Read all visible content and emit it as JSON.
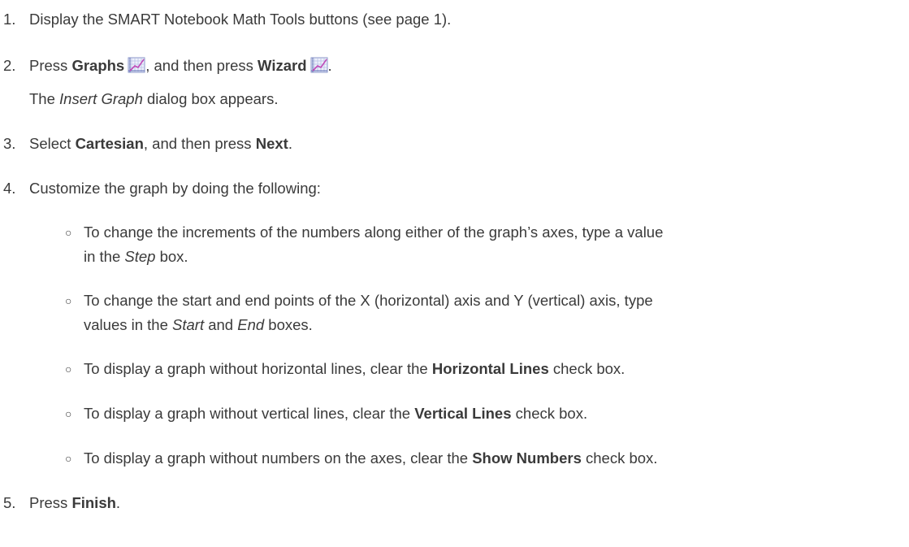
{
  "steps": [
    {
      "number": "1.",
      "text": "Display the SMART Notebook Math Tools buttons (see page 1)."
    },
    {
      "number": "2.",
      "press1": "Press ",
      "graphs": "Graphs",
      "icon1": "graph-icon",
      "and_then": ", and then press ",
      "wizard": "Wizard",
      "icon2": "graph-wizard-icon",
      "period": ".",
      "note_pre": "The ",
      "note_italic": "Insert Graph",
      "note_post": " dialog box appears."
    },
    {
      "number": "3.",
      "select": "Select ",
      "cartesian": "Cartesian",
      "and_then": ", and then press ",
      "next": "Next",
      "period": "."
    },
    {
      "number": "4.",
      "text": "Customize the graph by doing the following:"
    },
    {
      "number": "5.",
      "press": "Press ",
      "finish": "Finish",
      "period": "."
    }
  ],
  "sub_items": [
    {
      "bullet": "○",
      "line1": "To change the increments of the numbers along either of the graph’s axes, type a value",
      "line2_pre": "in the ",
      "line2_italic": "Step",
      "line2_post": " box."
    },
    {
      "bullet": "○",
      "line1": "To change the start and end points of the X (horizontal) axis and Y (vertical) axis, type",
      "line2_pre": "values in the ",
      "line2_italic1": "Start",
      "line2_mid": " and ",
      "line2_italic2": "End",
      "line2_post": " boxes."
    },
    {
      "bullet": "○",
      "pre": "To display a graph without horizontal lines, clear the ",
      "bold": "Horizontal Lines",
      "post": " check box."
    },
    {
      "bullet": "○",
      "pre": "To display a graph without vertical lines, clear the ",
      "bold": "Vertical Lines",
      "post": " check box."
    },
    {
      "bullet": "○",
      "pre": "To display a graph without numbers on the axes, clear the ",
      "bold": "Show Numbers",
      "post": " check box."
    }
  ],
  "colors": {
    "text": "#3a3a3a",
    "icon_grid": "#9aa7d6",
    "icon_curve": "#c04ab8",
    "icon_bg": "#eef0fb"
  }
}
